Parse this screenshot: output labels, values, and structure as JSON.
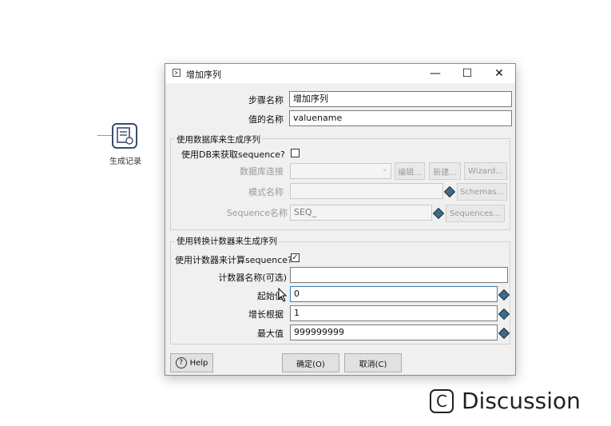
{
  "canvas": {
    "step_label": "生成记录"
  },
  "dialog": {
    "title": "增加序列",
    "window_controls": {
      "minimize": "—",
      "maximize": "☐",
      "close": "✕"
    },
    "step_name": {
      "label": "步骤名称",
      "value": "增加序列"
    },
    "value_name": {
      "label": "值的名称",
      "value": "valuename"
    },
    "db_group": {
      "title": "使用数据库来生成序列",
      "use_db_label": "使用DB来获取sequence?",
      "use_db_checked": "",
      "connection_label": "数据库连接",
      "connection_value": "",
      "edit_btn": "编辑...",
      "new_btn": "新建...",
      "wizard_btn": "Wizard...",
      "schema_label": "模式名称",
      "schema_value": "",
      "schemas_btn": "Schemas...",
      "sequence_label": "Sequence名称",
      "sequence_value": "SEQ_",
      "sequences_btn": "Sequences..."
    },
    "counter_group": {
      "title": "使用转换计数器来生成序列",
      "use_counter_label": "使用计数器来计算sequence?",
      "use_counter_checked": "✓",
      "counter_name_label": "计数器名称(可选)",
      "counter_name_value": "",
      "start_label": "起始值",
      "start_value": "0",
      "increment_label": "增长根据",
      "increment_value": "1",
      "max_label": "最大值",
      "max_value": "999999999"
    },
    "help_btn": "Help",
    "ok_btn": "确定(O)",
    "cancel_btn": "取消(C)"
  },
  "watermark": {
    "badge": "C",
    "text": "Discussion"
  },
  "colors": {
    "accent": "#3d6b8a",
    "dialog_bg": "#f0f0f0"
  }
}
